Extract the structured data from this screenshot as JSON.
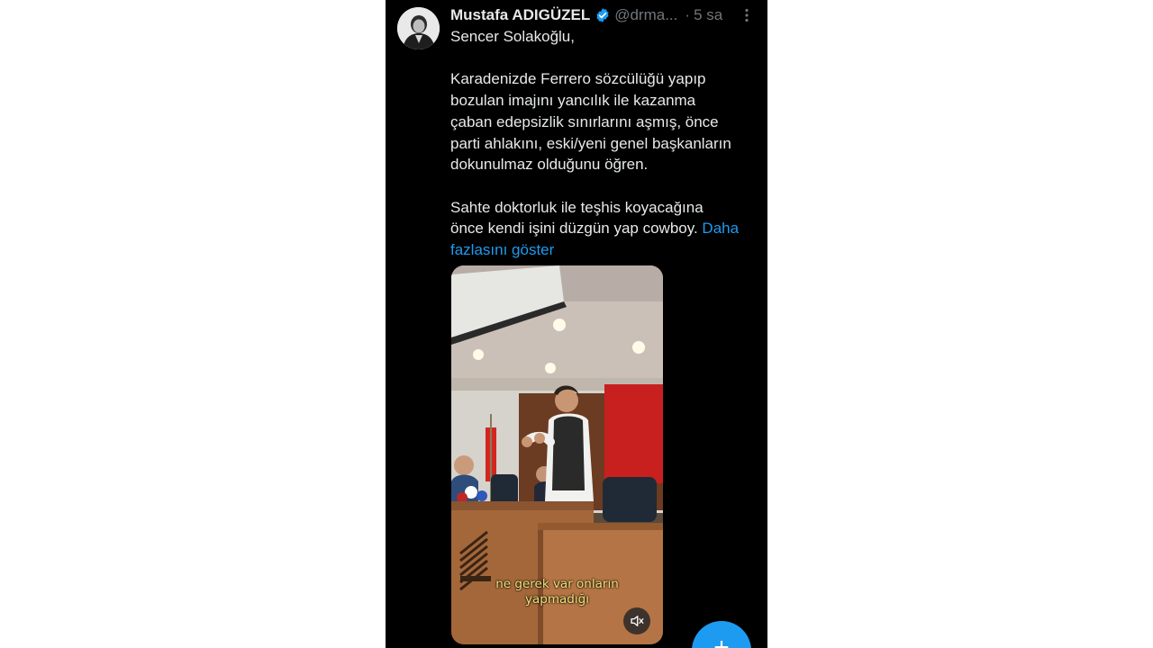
{
  "tweet": {
    "author_name": "Mustafa ADIGÜZEL",
    "handle": "@drma...",
    "separator": "·",
    "time": "5 sa",
    "verified": true,
    "paragraphs": [
      "Sencer Solakoğlu,",
      "Karadenizde Ferrero sözcülüğü yapıp\nbozulan imajını  yancılık ile kazanma\nçaban edepsizlik sınırlarını aşmış, önce\nparti ahlakını, eski/yeni genel başkanların\ndokunulmaz olduğunu öğren."
    ],
    "last_paragraph": "Sahte doktorluk ile teşhis koyacağına\nönce kendi işini düzgün yap cowboy. ",
    "show_more_label": "Daha\nfazlasını göster",
    "video": {
      "subtitle": "ne gerek var onların\nyapmadığı",
      "muted": true
    }
  },
  "colors": {
    "background": "#000000",
    "text": "#e7e9ea",
    "muted": "#71767b",
    "accent": "#1d9bf0"
  },
  "icons": {
    "verified": "verified-badge-icon",
    "more": "more-vertical-icon",
    "mute": "speaker-muted-icon",
    "compose": "plus-icon"
  },
  "fab": {
    "label": "+"
  }
}
